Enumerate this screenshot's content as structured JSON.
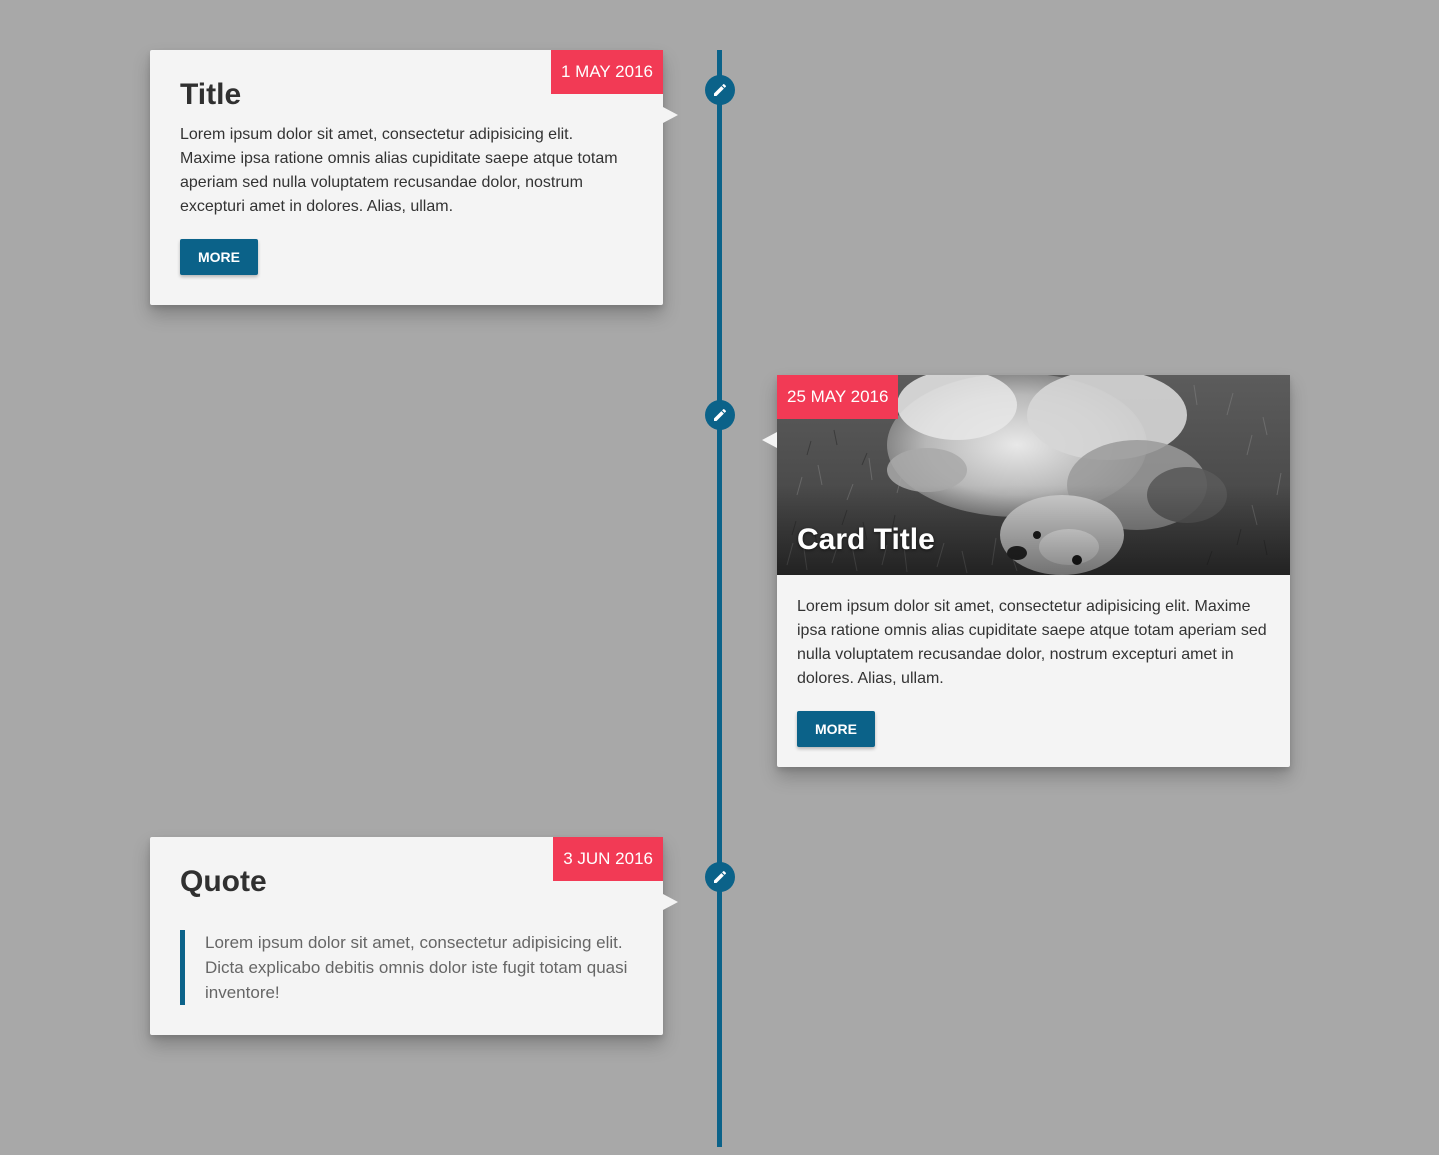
{
  "timeline": {
    "accent_color": "#0b6289",
    "badge_color": "#f23a55",
    "marker_icon": "pencil-icon",
    "entries": [
      {
        "date": "1 MAY 2016",
        "title": "Title",
        "text": "Lorem ipsum dolor sit amet, consectetur adipisicing elit. Maxime ipsa ratione omnis alias cupiditate saepe atque totam aperiam sed nulla voluptatem recusandae dolor, nostrum excepturi amet in dolores. Alias, ullam.",
        "button_label": "MORE"
      },
      {
        "date": "25 MAY 2016",
        "title": "Card Title",
        "image": "grayscale photo of a dog lying on its back in the grass",
        "text": "Lorem ipsum dolor sit amet, consectetur adipisicing elit. Maxime ipsa ratione omnis alias cupiditate saepe atque totam aperiam sed nulla voluptatem recusandae dolor, nostrum excepturi amet in dolores. Alias, ullam.",
        "button_label": "MORE"
      },
      {
        "date": "3 JUN 2016",
        "title": "Quote",
        "quote": "Lorem ipsum dolor sit amet, consectetur adipisicing elit. Dicta explicabo debitis omnis dolor iste fugit totam quasi inventore!"
      }
    ]
  }
}
